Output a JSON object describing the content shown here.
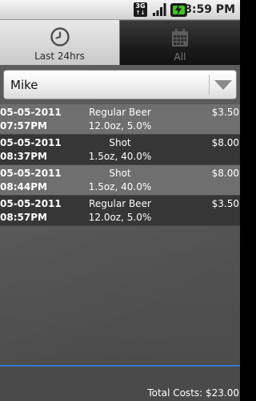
{
  "status_bar": {
    "network_type": "3G",
    "time": "8:59 PM",
    "icons": [
      "3g-icon",
      "signal-strength-icon",
      "battery-charging-icon"
    ]
  },
  "tabs": [
    {
      "label": "Last 24hrs",
      "icon": "clock-icon",
      "selected": true
    },
    {
      "label": "All",
      "icon": "calendar-icon",
      "selected": false
    }
  ],
  "person_spinner": {
    "selected": "Mike",
    "icon": "dropdown-arrow-icon"
  },
  "drinks": [
    {
      "date": "05-05-2011",
      "time": "07:57PM",
      "type": "Regular Beer",
      "amount": "12.0oz, 5.0%",
      "cost": "$3.50"
    },
    {
      "date": "05-05-2011",
      "time": "08:37PM",
      "type": "Shot",
      "amount": "1.5oz, 40.0%",
      "cost": "$8.00"
    },
    {
      "date": "05-05-2011",
      "time": "08:44PM",
      "type": "Shot",
      "amount": "1.5oz, 40.0%",
      "cost": "$8.00"
    },
    {
      "date": "05-05-2011",
      "time": "08:57PM",
      "type": "Regular Beer",
      "amount": "12.0oz, 5.0%",
      "cost": "$3.50"
    }
  ],
  "footer": {
    "total_costs": "Total Costs: $23.00"
  },
  "colors": {
    "accent": "#3578d8",
    "row_light": "#6f6f6f",
    "row_dark": "#363636",
    "battery": "#41c51d"
  }
}
